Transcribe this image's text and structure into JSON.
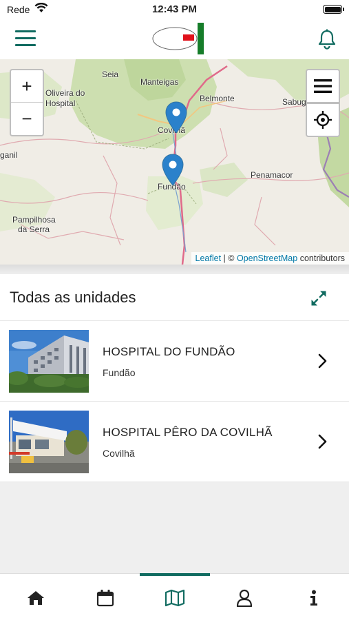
{
  "status_bar": {
    "carrier": "Rede",
    "time": "12:43 PM"
  },
  "header": {
    "menu_icon": "hamburger-menu-icon",
    "notifications_icon": "bell-icon"
  },
  "map": {
    "zoom_in_label": "+",
    "zoom_out_label": "−",
    "places": [
      "Seia",
      "Manteigas",
      "Oliveira do",
      "Hospital",
      "Belmonte",
      "Sabug",
      "Covilhã",
      "ganil",
      "Penamacor",
      "Fundão",
      "Pampilhosa",
      "da Serra"
    ],
    "attribution": {
      "leaflet": "Leaflet",
      "separator": "| ©",
      "osm": "OpenStreetMap",
      "suffix": "contributors"
    },
    "markers": [
      "Covilhã",
      "Fundão"
    ]
  },
  "list": {
    "title": "Todas as unidades",
    "items": [
      {
        "name": "HOSPITAL DO FUNDÃO",
        "city": "Fundão"
      },
      {
        "name": "HOSPITAL PÊRO DA COVILHÃ",
        "city": "Covilhã"
      }
    ]
  },
  "tabs": [
    {
      "icon": "home-icon"
    },
    {
      "icon": "calendar-icon"
    },
    {
      "icon": "map-icon",
      "active": true
    },
    {
      "icon": "user-icon"
    },
    {
      "icon": "info-icon"
    }
  ],
  "colors": {
    "accent": "#106b60",
    "marker": "#2a81cb",
    "link": "#0078a8"
  }
}
